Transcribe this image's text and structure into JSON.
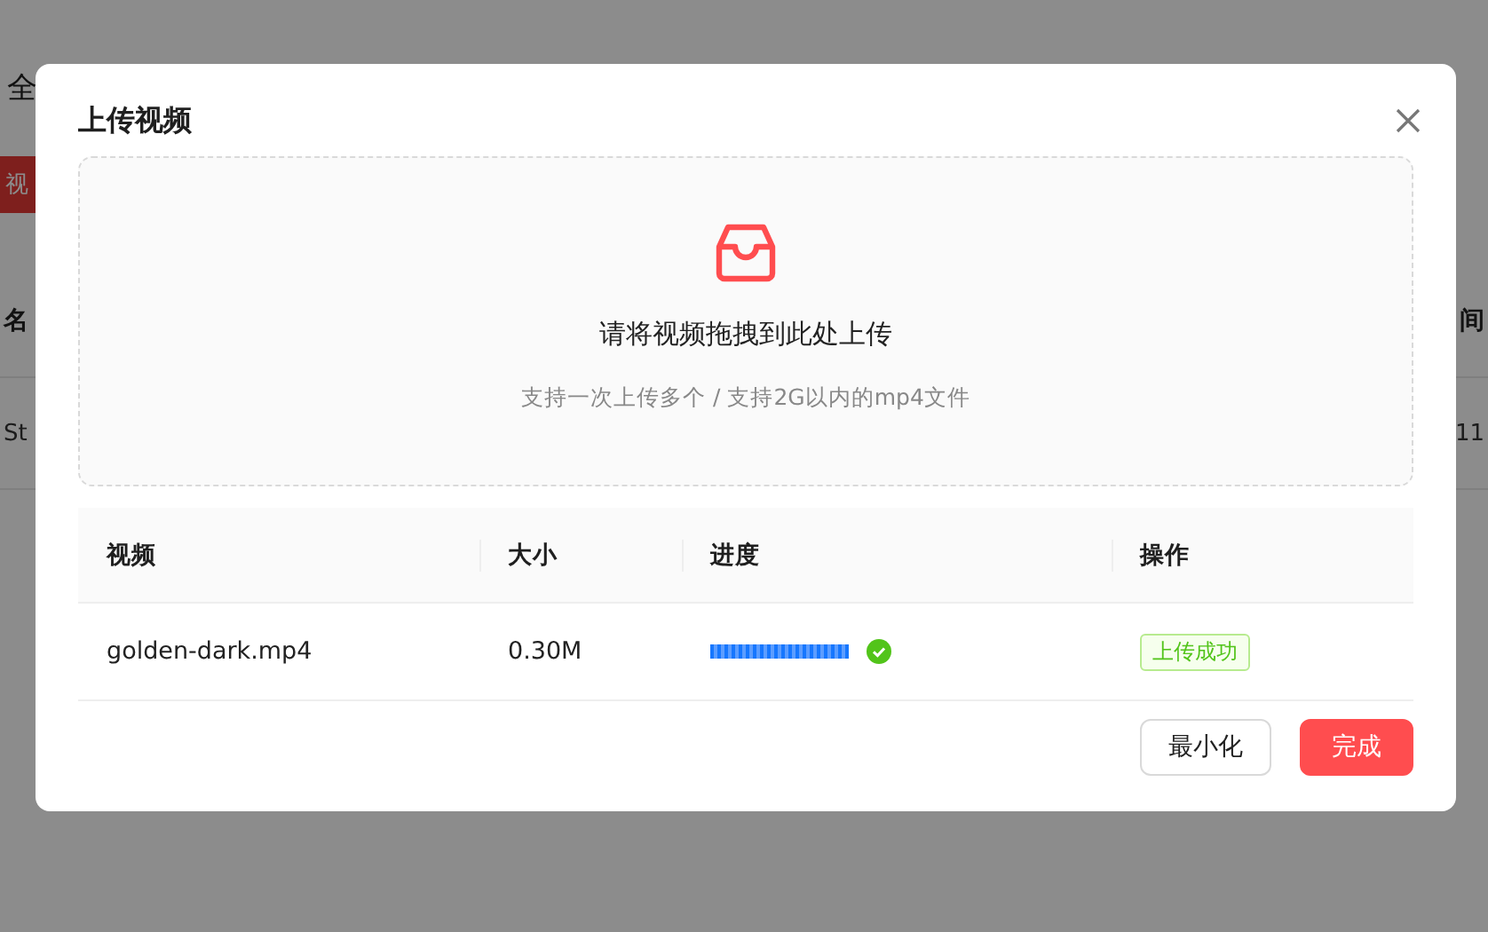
{
  "background_page": {
    "top_label": "全",
    "red_button": "视",
    "table_header": {
      "column_1": "名",
      "column_2": "间"
    },
    "table_row": {
      "column_1": "St",
      "column_2": "11"
    }
  },
  "dialog": {
    "title": "上传视频",
    "drop_zone": {
      "title": "请将视频拖拽到此处上传",
      "hint": "支持一次上传多个 / 支持2G以内的mp4文件"
    },
    "table": {
      "columns": [
        "视频",
        "大小",
        "进度",
        "操作"
      ],
      "rows": [
        {
          "video": "golden-dark.mp4",
          "size": "0.30M",
          "progress": {
            "level": 1,
            "complete": true
          },
          "action": {
            "label": "上传成功",
            "kind": "success"
          }
        }
      ]
    },
    "buttons": [
      {
        "label": "最小化",
        "kind": "default"
      },
      {
        "label": "完成",
        "kind": "primary"
      }
    ]
  }
}
